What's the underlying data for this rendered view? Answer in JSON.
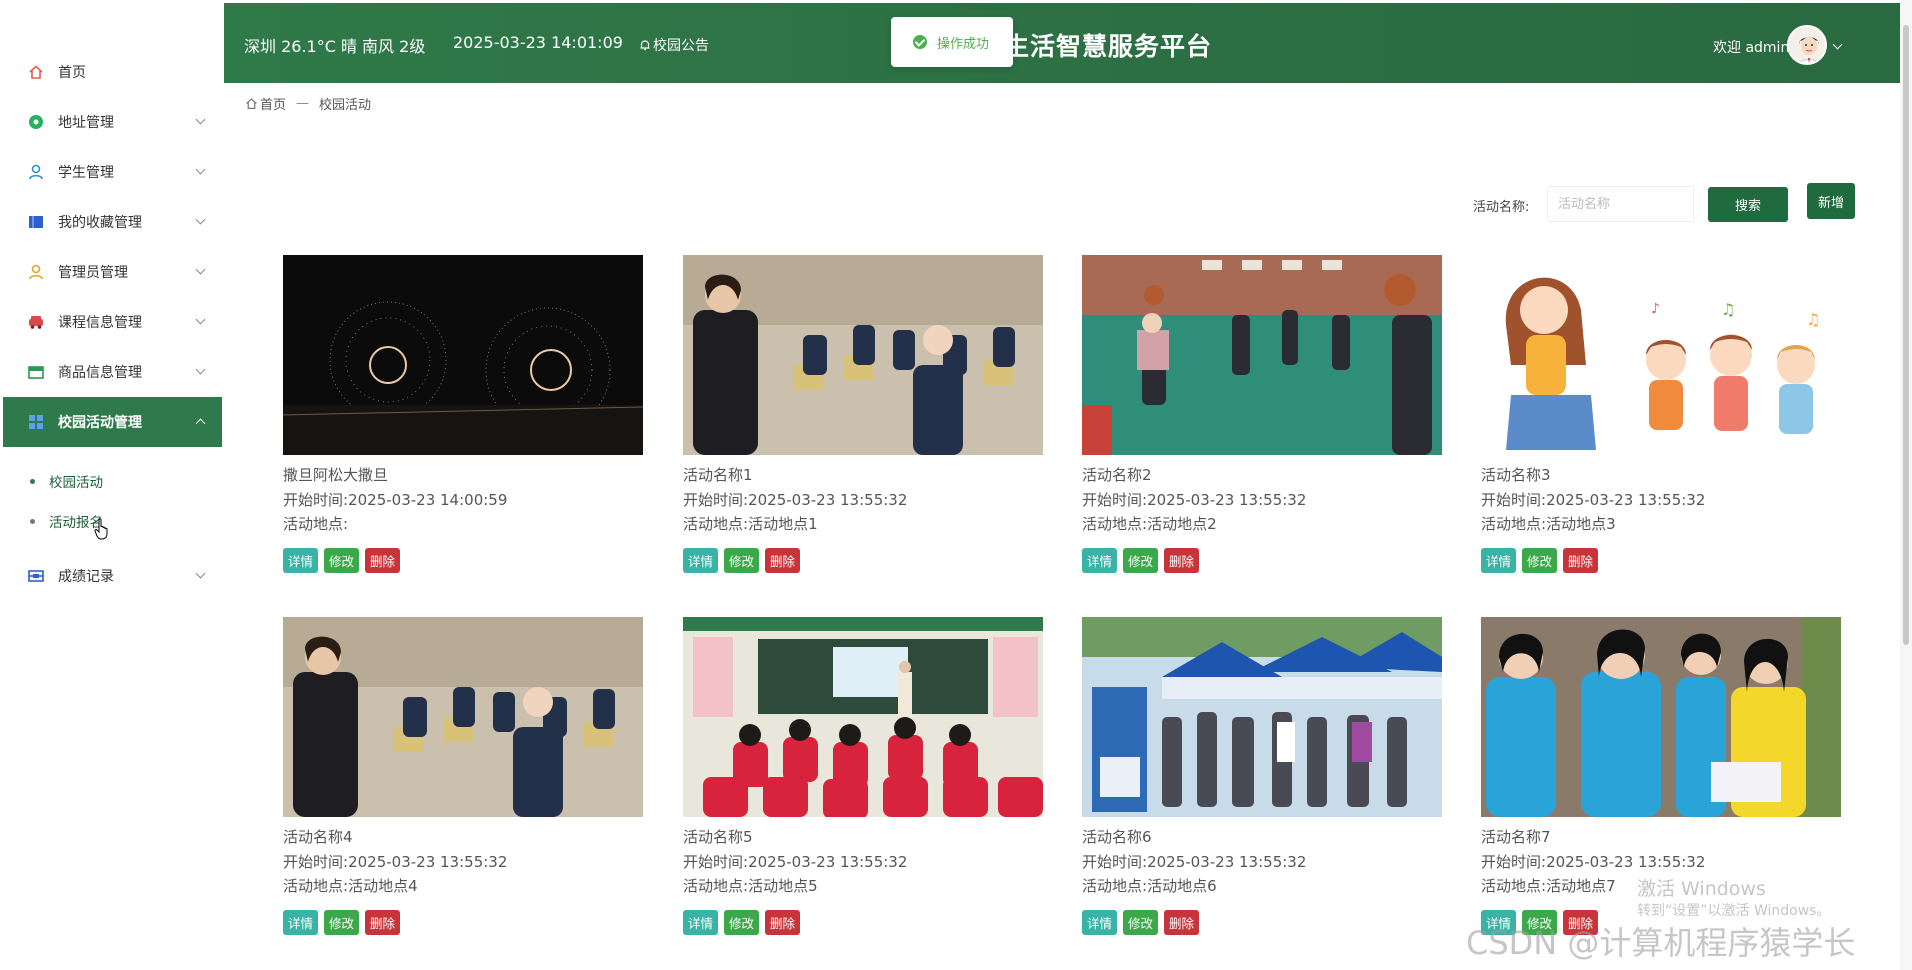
{
  "sidebar": {
    "items": [
      {
        "label": "首页",
        "icon": "home-icon",
        "color": "#e25c4a",
        "expandable": false
      },
      {
        "label": "地址管理",
        "icon": "location-icon",
        "color": "#22b35c",
        "expandable": true
      },
      {
        "label": "学生管理",
        "icon": "user-icon",
        "color": "#2f8fd4",
        "expandable": true
      },
      {
        "label": "我的收藏管理",
        "icon": "bookmark-icon",
        "color": "#2e5fd1",
        "expandable": true
      },
      {
        "label": "管理员管理",
        "icon": "admin-icon",
        "color": "#e2a52e",
        "expandable": true
      },
      {
        "label": "课程信息管理",
        "icon": "car-icon",
        "color": "#d94b4b",
        "expandable": true
      },
      {
        "label": "商品信息管理",
        "icon": "store-icon",
        "color": "#2a9a55",
        "expandable": true
      },
      {
        "label": "校园活动管理",
        "icon": "grid-icon",
        "color": "#ffffff",
        "expandable": true,
        "active": true
      },
      {
        "label": "成绩记录",
        "icon": "record-icon",
        "color": "#2f5fd0",
        "expandable": true
      }
    ],
    "submenu": [
      {
        "label": "校园活动",
        "selected": true
      },
      {
        "label": "活动报名",
        "selected": false
      }
    ]
  },
  "header": {
    "weather": "深圳 26.1°C 晴 南风 2级",
    "datetime": "2025-03-23 14:01:09",
    "notice": "校园公告",
    "title": "生活智慧服务平台",
    "welcome": "欢迎 admin"
  },
  "toast": {
    "message": "操作成功"
  },
  "breadcrumb": {
    "home": "首页",
    "separator": "—",
    "current": "校园活动"
  },
  "search": {
    "label": "活动名称:",
    "placeholder": "活动名称",
    "button": "搜索",
    "add_button": "新增"
  },
  "card_buttons": {
    "detail": "详情",
    "edit": "修改",
    "delete": "删除"
  },
  "field_labels": {
    "start": "开始时间:",
    "place": "活动地点:"
  },
  "activities": [
    {
      "name": "撒旦阿松大撒旦",
      "start": "2025-03-23 14:00:59",
      "place": "",
      "image": "fireworks"
    },
    {
      "name": "活动名称1",
      "start": "2025-03-23 13:55:32",
      "place": "活动地点1",
      "image": "auditorium"
    },
    {
      "name": "活动名称2",
      "start": "2025-03-23 13:55:32",
      "place": "活动地点2",
      "image": "playground"
    },
    {
      "name": "活动名称3",
      "start": "2025-03-23 13:55:32",
      "place": "活动地点3",
      "image": "cartoon-singing"
    },
    {
      "name": "活动名称4",
      "start": "2025-03-23 13:55:32",
      "place": "活动地点4",
      "image": "auditorium"
    },
    {
      "name": "活动名称5",
      "start": "2025-03-23 13:55:32",
      "place": "活动地点5",
      "image": "classroom"
    },
    {
      "name": "活动名称6",
      "start": "2025-03-23 13:55:32",
      "place": "活动地点6",
      "image": "tents"
    },
    {
      "name": "活动名称7",
      "start": "2025-03-23 13:55:32",
      "place": "活动地点7",
      "image": "volunteers"
    }
  ],
  "watermarks": {
    "windows": "激活 Windows",
    "windows_sub": "转到“设置”以激活 Windows。",
    "csdn": "CSDN @计算机程序猿学长"
  },
  "colors": {
    "primary": "#2f7a4a",
    "detail": "#39b3a5",
    "edit": "#3ba94a",
    "delete": "#c9343a"
  }
}
